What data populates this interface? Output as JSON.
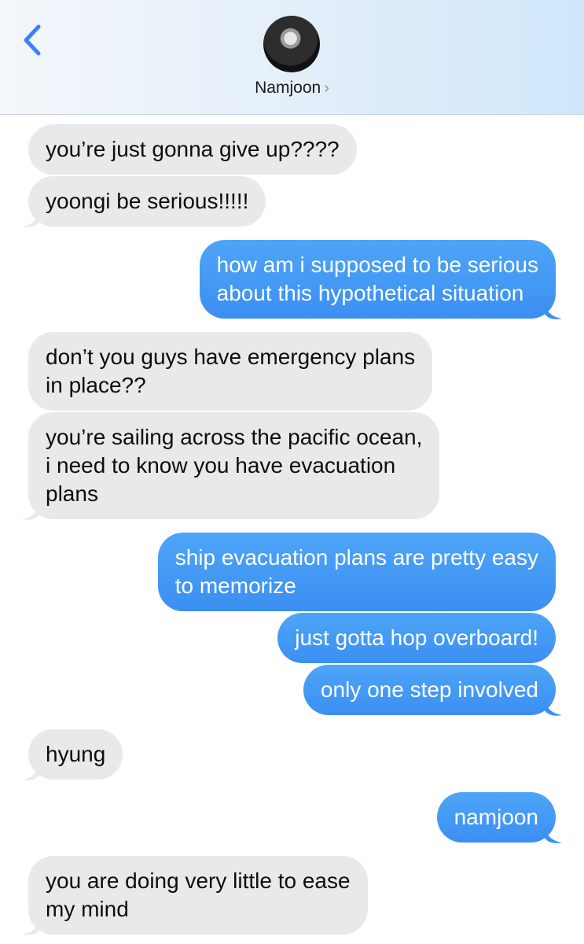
{
  "contact": {
    "name": "Namjoon",
    "chevron": "›"
  },
  "icons": {
    "back": "chevron-left-icon",
    "avatar": "contact-avatar"
  },
  "colors": {
    "incoming": "#e9e9eb",
    "outgoing": "#3b8ff2",
    "back": "#3a82f7"
  },
  "messages": [
    {
      "from": "them",
      "lines": [
        "you’re just gonna give up????"
      ]
    },
    {
      "from": "them",
      "lines": [
        "yoongi be serious!!!!!"
      ]
    },
    {
      "from": "me",
      "lines": [
        "how am i supposed to be serious",
        "about this hypothetical situation"
      ]
    },
    {
      "from": "them",
      "lines": [
        "don’t you guys have emergency plans",
        "in place??"
      ]
    },
    {
      "from": "them",
      "lines": [
        "you’re sailing across the pacific ocean,",
        "i need to know you have evacuation",
        "plans"
      ]
    },
    {
      "from": "me",
      "lines": [
        "ship evacuation plans are pretty easy",
        "to memorize"
      ]
    },
    {
      "from": "me",
      "lines": [
        "just gotta hop overboard!"
      ]
    },
    {
      "from": "me",
      "lines": [
        "only one step involved"
      ]
    },
    {
      "from": "them",
      "lines": [
        "hyung"
      ]
    },
    {
      "from": "me",
      "lines": [
        "namjoon"
      ]
    },
    {
      "from": "them",
      "lines": [
        "you are doing very little to ease",
        "my mind"
      ]
    }
  ]
}
